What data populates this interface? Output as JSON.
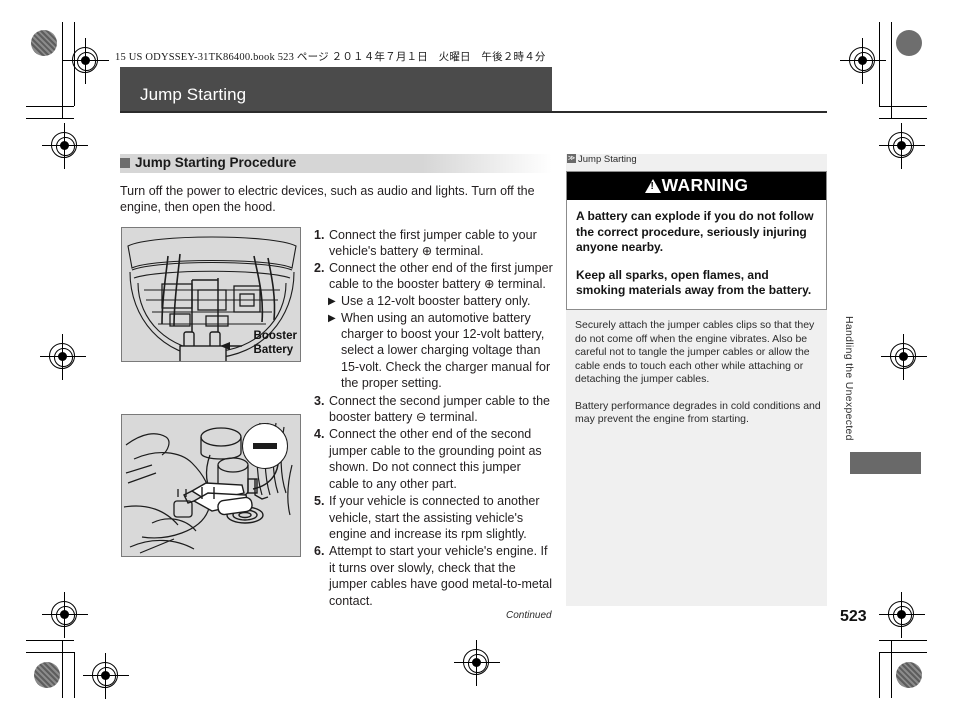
{
  "print": {
    "file_header": "15 US ODYSSEY-31TK86400.book   523 ページ   ２０１４年７月１日　火曜日　午後２時４分"
  },
  "section": {
    "title": "Jump Starting"
  },
  "left": {
    "heading": "Jump Starting Procedure",
    "intro": "Turn off the power to electric devices, such as audio and lights. Turn off the engine, then open the hood.",
    "steps": [
      {
        "n": "1.",
        "text": "Connect the first jumper cable to your vehicle's battery ⊕ terminal."
      },
      {
        "n": "2.",
        "text": "Connect the other end of the first jumper cable to the booster battery ⊕ terminal.",
        "subs": [
          "Use a 12-volt booster battery only.",
          "When using an automotive battery charger to boost your 12-volt battery, select a lower charging voltage than 15-volt. Check the charger manual for the proper setting."
        ]
      },
      {
        "n": "3.",
        "text": "Connect the second jumper cable to the booster battery ⊖ terminal."
      },
      {
        "n": "4.",
        "text": "Connect the other end of the second jumper cable to the grounding point as shown. Do not connect this jumper cable to any other part."
      },
      {
        "n": "5.",
        "text": "If your vehicle is connected to another vehicle, start the assisting vehicle's engine and increase its rpm slightly."
      },
      {
        "n": "6.",
        "text": "Attempt to start your vehicle's engine. If it turns over slowly, check that the jumper cables have good metal-to-metal contact."
      }
    ],
    "figure1_label_line1": "Booster",
    "figure1_label_line2": "Battery",
    "figure2_symbol": "−"
  },
  "sidebar": {
    "header_label": "Jump Starting",
    "warning_title": "WARNING",
    "warning_paragraphs": [
      "A battery can explode if you do not follow the correct procedure, seriously injuring anyone nearby.",
      "Keep all sparks, open flames, and smoking materials away from the battery."
    ],
    "notes": [
      "Securely attach the jumper cables clips so that they do not come off when the engine vibrates. Also be careful not to tangle the jumper cables or allow the cable ends to touch each other while attaching or detaching the jumper cables.",
      "Battery performance degrades in cold conditions and may prevent the engine from starting."
    ]
  },
  "edge_tab": {
    "label": "Handling the Unexpected"
  },
  "footer": {
    "continued": "Continued",
    "page_number": "523"
  },
  "colors": {
    "title_bar": "#4b4b4b",
    "heading_band": "#d6d6d6",
    "sidebar_bg": "#f0f0f0",
    "warning_bar": "#000000",
    "figure_bg": "#d9d9d9",
    "edge_tab": "#696969"
  }
}
